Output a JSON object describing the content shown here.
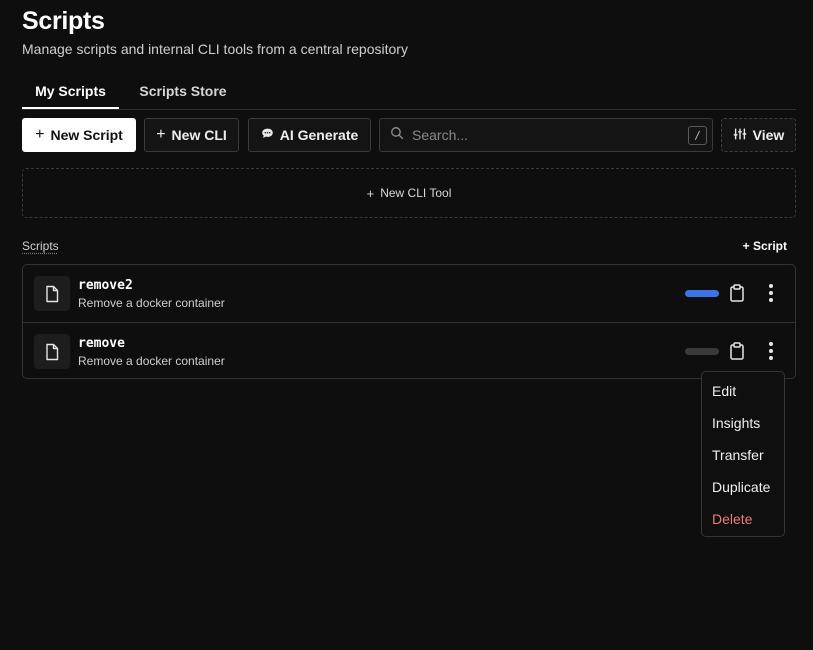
{
  "header": {
    "title": "Scripts",
    "subtitle": "Manage scripts and internal CLI tools from a central repository"
  },
  "tabs": [
    {
      "label": "My Scripts",
      "active": true
    },
    {
      "label": "Scripts Store",
      "active": false
    }
  ],
  "toolbar": {
    "new_script_label": "New Script",
    "new_cli_label": "New CLI",
    "ai_generate_label": "AI Generate",
    "search_placeholder": "Search...",
    "search_shortcut": "/",
    "view_label": "View"
  },
  "new_cli_tool": {
    "label": "New CLI Tool"
  },
  "scripts_section": {
    "label": "Scripts",
    "add_label": "Script"
  },
  "scripts": [
    {
      "name": "remove2",
      "description": "Remove a docker container",
      "enabled": true
    },
    {
      "name": "remove",
      "description": "Remove a docker container",
      "enabled": false
    }
  ],
  "context_menu": {
    "items": [
      {
        "label": "Edit"
      },
      {
        "label": "Insights"
      },
      {
        "label": "Transfer"
      },
      {
        "label": "Duplicate"
      },
      {
        "label": "Delete",
        "danger": true
      }
    ]
  },
  "colors": {
    "background": "#0e0e0e",
    "toggle_on": "#3b73e8",
    "toggle_off": "#3a3a3a",
    "danger": "#f07a7a"
  }
}
